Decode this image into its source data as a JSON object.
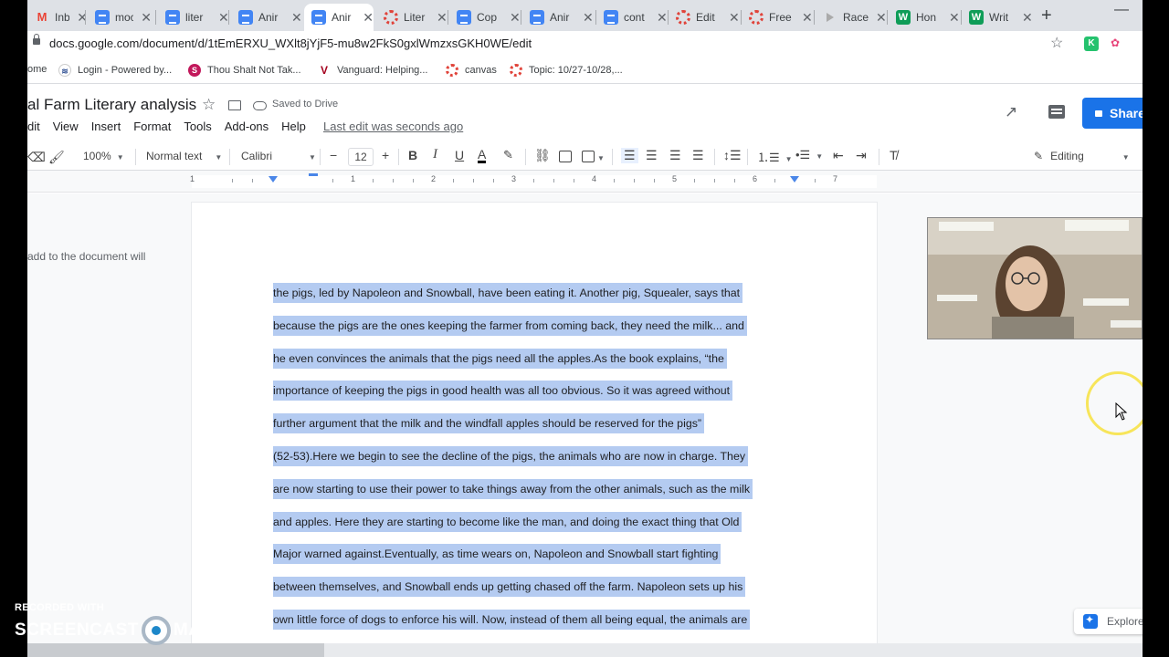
{
  "browser": {
    "tabs": [
      {
        "label": "Inbo",
        "icon": "gmail-icon",
        "active": false
      },
      {
        "label": "moc",
        "icon": "docs-icon",
        "active": false
      },
      {
        "label": "liter",
        "icon": "docs-icon",
        "active": false
      },
      {
        "label": "Anir",
        "icon": "docs-icon",
        "active": false
      },
      {
        "label": "Anir",
        "icon": "docs-icon",
        "active": true
      },
      {
        "label": "Liter",
        "icon": "canvas-icon",
        "active": false
      },
      {
        "label": "Cop",
        "icon": "docs-icon",
        "active": false
      },
      {
        "label": "Anir",
        "icon": "docs-icon",
        "active": false
      },
      {
        "label": "cont",
        "icon": "docs-icon",
        "active": false
      },
      {
        "label": "Edit",
        "icon": "canvas-icon",
        "active": false
      },
      {
        "label": "Free",
        "icon": "canvas-icon",
        "active": false
      },
      {
        "label": "Race",
        "icon": "video-icon",
        "active": false
      },
      {
        "label": "Hon",
        "icon": "w-icon",
        "active": false
      },
      {
        "label": "Writ",
        "icon": "w-icon",
        "active": false
      }
    ],
    "url": "docs.google.com/document/d/1tEmERXU_WXlt8jYjF5-mu8w2FkS0gxlWmzxsGKH0WE/edit",
    "bookmarks": [
      {
        "label": "ome"
      },
      {
        "label": "Login - Powered by..."
      },
      {
        "label": "Thou Shalt Not Tak..."
      },
      {
        "label": "Vanguard: Helping..."
      },
      {
        "label": "canvas"
      },
      {
        "label": "Topic: 10/27-10/28,..."
      }
    ]
  },
  "docs": {
    "title": "al Farm Literary analysis",
    "saved_status": "Saved to Drive",
    "menu": [
      "dit",
      "View",
      "Insert",
      "Format",
      "Tools",
      "Add-ons",
      "Help"
    ],
    "last_edit": "Last edit was seconds ago",
    "share_label": "Share",
    "toolbar": {
      "zoom": "100%",
      "style": "Normal text",
      "font": "Calibri",
      "font_size": "12",
      "mode": "Editing"
    },
    "ruler_numbers": [
      "1",
      "1",
      "2",
      "3",
      "4",
      "5",
      "6",
      "7"
    ],
    "outline_text": "add to the document will",
    "body_lines": [
      "the pigs, led by Napoleon and Snowball,  have been eating it. Another pig, Squealer, says that",
      "because the pigs are the ones keeping the farmer from coming back, they need the milk... and",
      "he even convinces the animals that the pigs need all the apples.As the book explains, “the",
      "importance of keeping the pigs in good health was all too obvious. So it was agreed without",
      "further argument that the milk and the windfall apples should be reserved for the pigs”",
      "(52-53).Here we begin to see the decline of the pigs, the animals who are now in charge. They",
      "are now starting to use their power to take things away from the other animals, such as the milk",
      "and apples. Here they are starting to become like the man, and doing the exact thing that Old",
      "Major warned against.Eventually, as time wears on, Napoleon and Snowball start fighting",
      "between themselves, and Snowball ends up getting chased off the farm. Napoleon sets up his",
      "own little force of dogs to enforce his will. Now, instead of them all being equal, the animals are"
    ],
    "explore_label": "Explore"
  },
  "watermark": {
    "top": "RECORDED WITH",
    "left": "SCREENCAST",
    "right": "MATIC"
  },
  "colors": {
    "selection": "#b4cbf1",
    "share_blue": "#1a73e8",
    "cursor_ring": "#f7e55a"
  }
}
